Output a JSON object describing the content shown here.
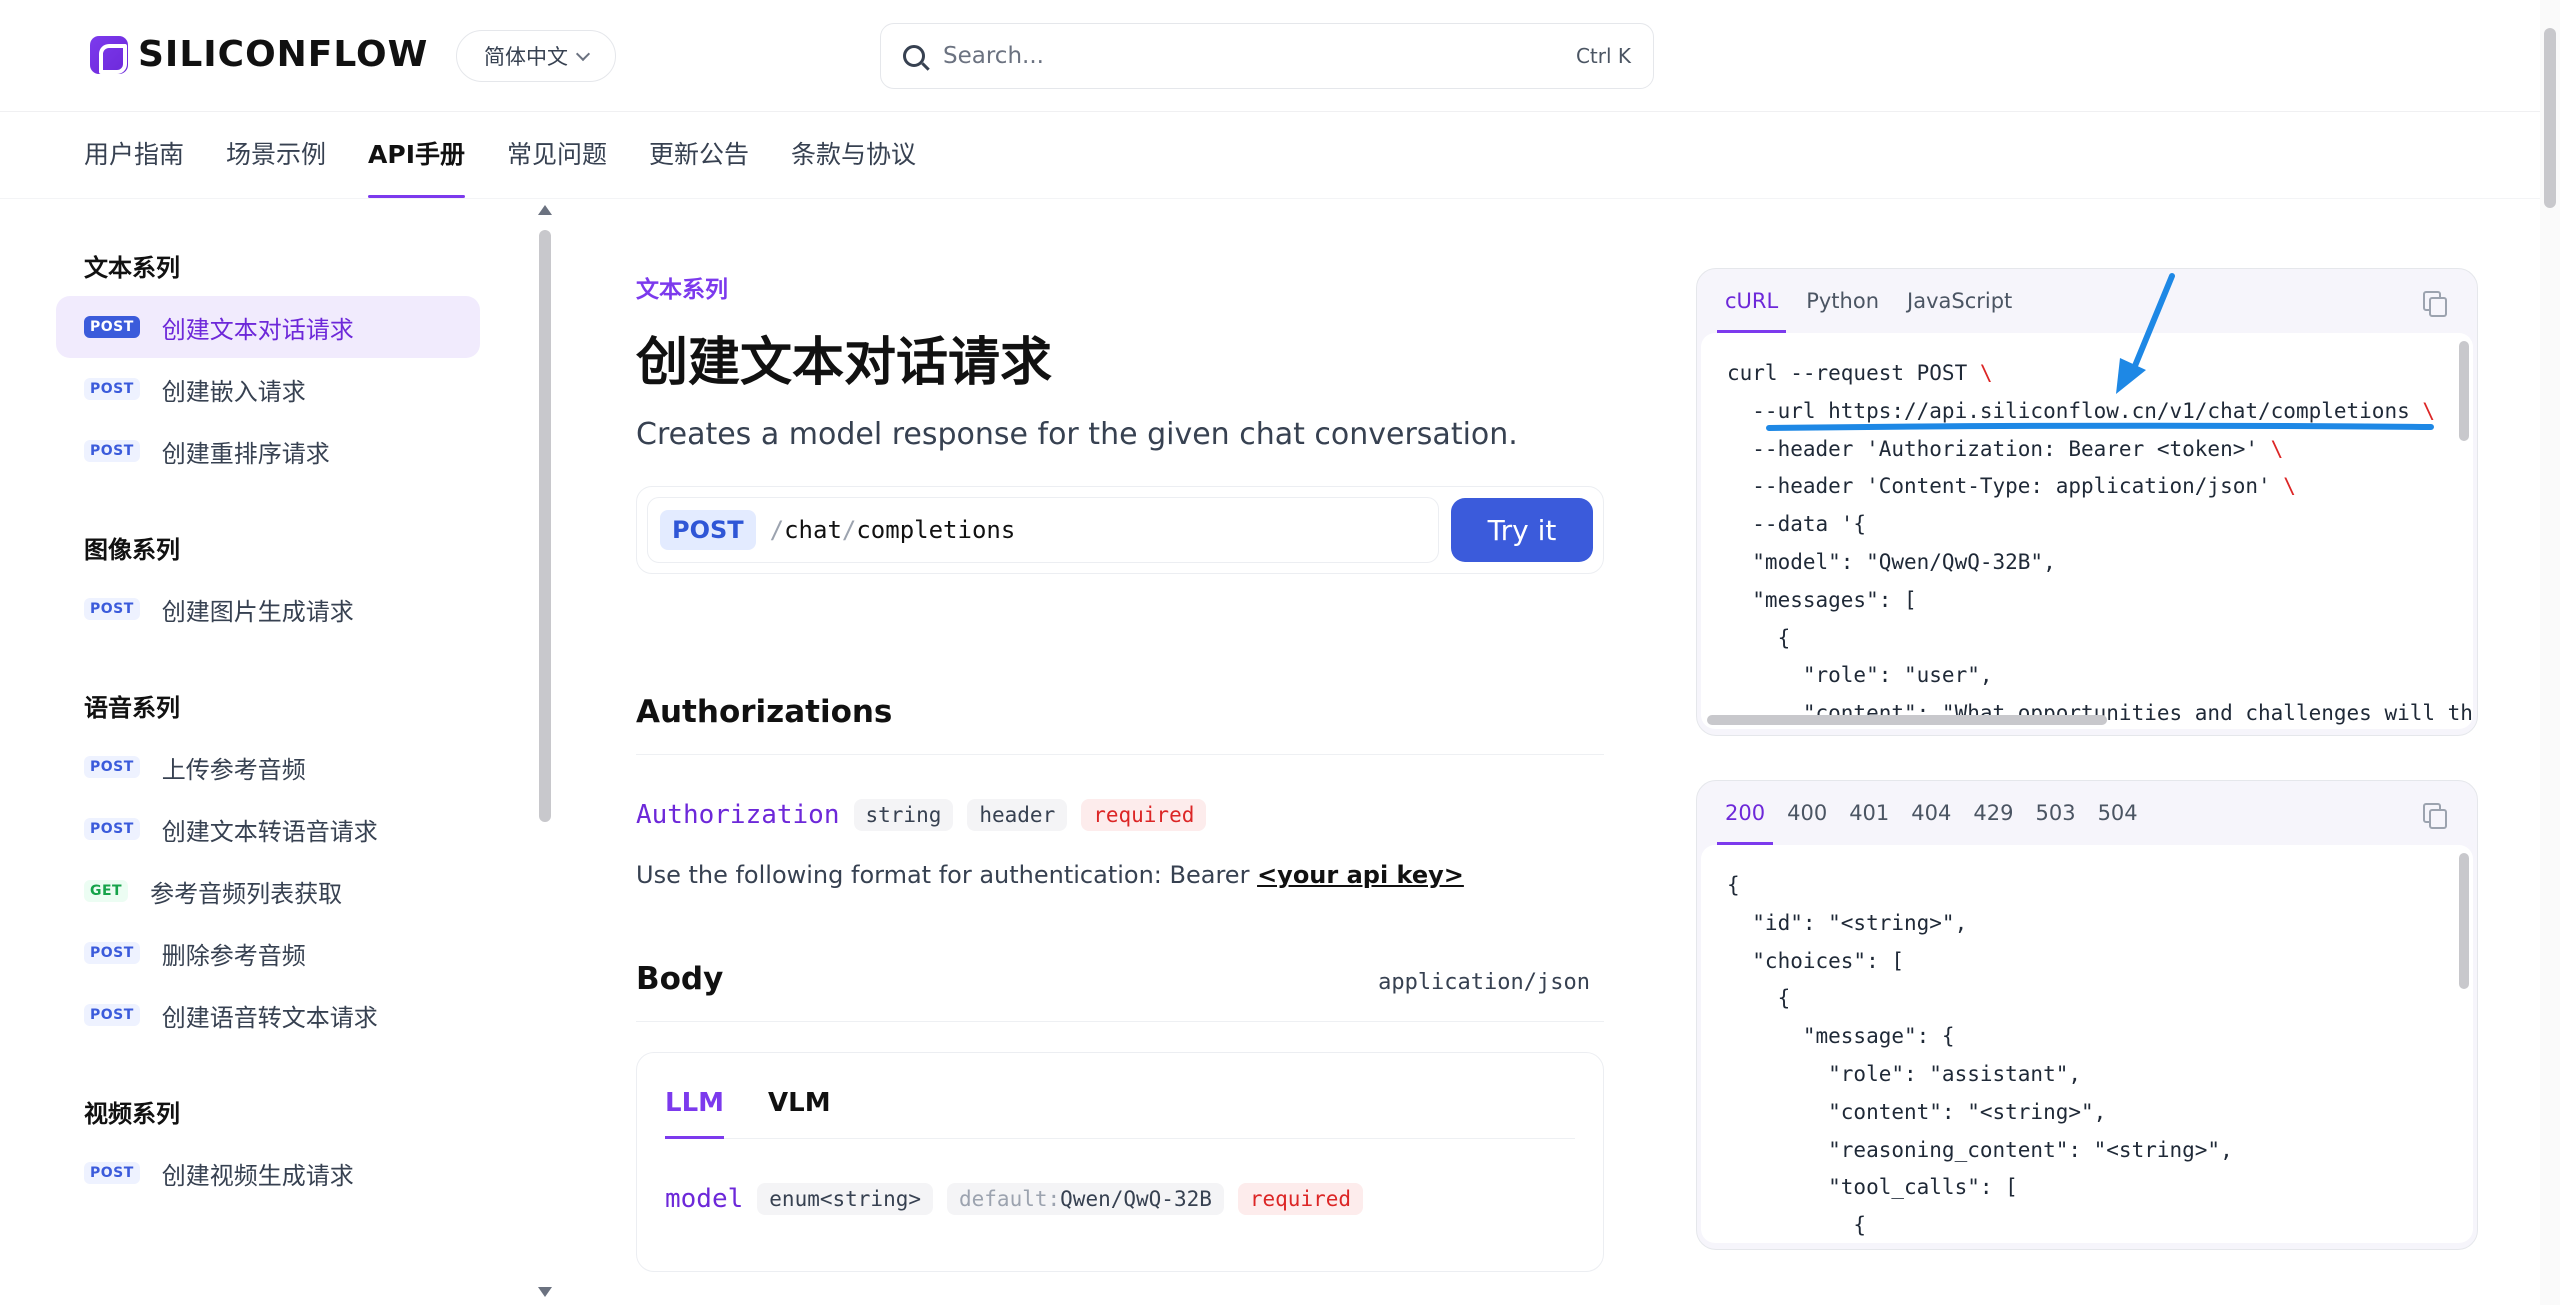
{
  "header": {
    "logo_text": "SILICONFLOW",
    "language": "简体中文",
    "search_placeholder": "Search...",
    "search_shortcut": "Ctrl K"
  },
  "nav": {
    "tabs": [
      "用户指南",
      "场景示例",
      "API手册",
      "常见问题",
      "更新公告",
      "条款与协议"
    ],
    "active": "API手册"
  },
  "sidebar": {
    "groups": [
      {
        "title": "文本系列",
        "items": [
          {
            "method": "POST",
            "label": "创建文本对话请求",
            "active": true
          },
          {
            "method": "POST",
            "label": "创建嵌入请求"
          },
          {
            "method": "POST",
            "label": "创建重排序请求"
          }
        ]
      },
      {
        "title": "图像系列",
        "items": [
          {
            "method": "POST",
            "label": "创建图片生成请求"
          }
        ]
      },
      {
        "title": "语音系列",
        "items": [
          {
            "method": "POST",
            "label": "上传参考音频"
          },
          {
            "method": "POST",
            "label": "创建文本转语音请求"
          },
          {
            "method": "GET",
            "label": "参考音频列表获取"
          },
          {
            "method": "POST",
            "label": "删除参考音频"
          },
          {
            "method": "POST",
            "label": "创建语音转文本请求"
          }
        ]
      },
      {
        "title": "视频系列",
        "items": [
          {
            "method": "POST",
            "label": "创建视频生成请求"
          }
        ]
      }
    ]
  },
  "main": {
    "eyebrow": "文本系列",
    "title": "创建文本对话请求",
    "subtitle": "Creates a model response for the given chat conversation.",
    "endpoint": {
      "method": "POST",
      "path_parts": [
        "chat",
        "completions"
      ],
      "try_label": "Try it"
    },
    "auth": {
      "heading": "Authorizations",
      "param": "Authorization",
      "type": "string",
      "location": "header",
      "required": "required",
      "desc_prefix": "Use the following format for authentication: Bearer ",
      "desc_link": "<your api key>"
    },
    "body": {
      "heading": "Body",
      "content_type": "application/json",
      "tabs": [
        "LLM",
        "VLM"
      ],
      "active_tab": "LLM",
      "model_param": "model",
      "model_type": "enum<string>",
      "model_default_label": "default:",
      "model_default_value": "Qwen/QwQ-32B",
      "model_required": "required"
    }
  },
  "request_panel": {
    "tabs": [
      "cURL",
      "Python",
      "JavaScript"
    ],
    "active": "cURL",
    "lines": [
      "curl --request POST \\",
      "  --url https://api.siliconflow.cn/v1/chat/completions \\",
      "  --header 'Authorization: Bearer <token>' \\",
      "  --header 'Content-Type: application/json' \\",
      "  --data '{",
      "  \"model\": \"Qwen/QwQ-32B\",",
      "  \"messages\": [",
      "    {",
      "      \"role\": \"user\",",
      "      \"content\": \"What opportunities and challenges will th"
    ]
  },
  "response_panel": {
    "tabs": [
      "200",
      "400",
      "401",
      "404",
      "429",
      "503",
      "504"
    ],
    "active": "200",
    "lines": [
      "{",
      "  \"id\": \"<string>\",",
      "  \"choices\": [",
      "    {",
      "      \"message\": {",
      "        \"role\": \"assistant\",",
      "        \"content\": \"<string>\",",
      "        \"reasoning_content\": \"<string>\",",
      "        \"tool_calls\": [",
      "          {"
    ]
  },
  "colors": {
    "accent": "#7c3aed",
    "primary_button": "#3b5bdb",
    "annotation": "#1e88e5"
  }
}
